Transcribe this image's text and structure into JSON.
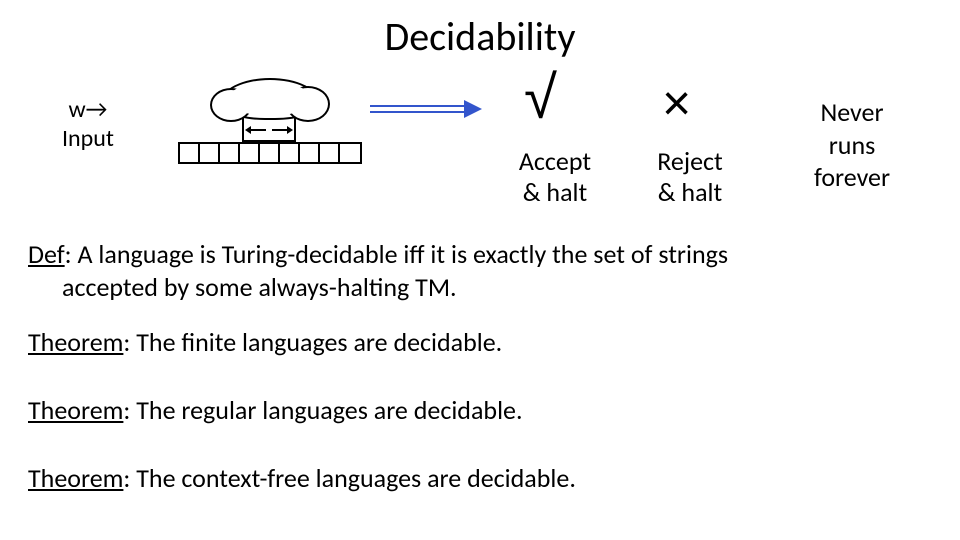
{
  "title": "Decidability",
  "input_label": "w→\nInput",
  "accept": {
    "mark": "√",
    "label": "Accept\n& halt"
  },
  "reject": {
    "mark": "×",
    "label": "Reject\n& halt"
  },
  "never": {
    "label": "Never\nruns\nforever"
  },
  "def": {
    "prefix": "Def",
    "line1": ": A language is Turing-decidable iff it is exactly the set of strings",
    "line2": "accepted by some always-halting TM."
  },
  "theorem1": {
    "prefix": "Theorem",
    "text": ": The finite languages are decidable."
  },
  "theorem2": {
    "prefix": "Theorem",
    "text": ": The regular languages are decidable."
  },
  "theorem3": {
    "prefix": "Theorem",
    "text": ": The context-free languages are decidable."
  }
}
